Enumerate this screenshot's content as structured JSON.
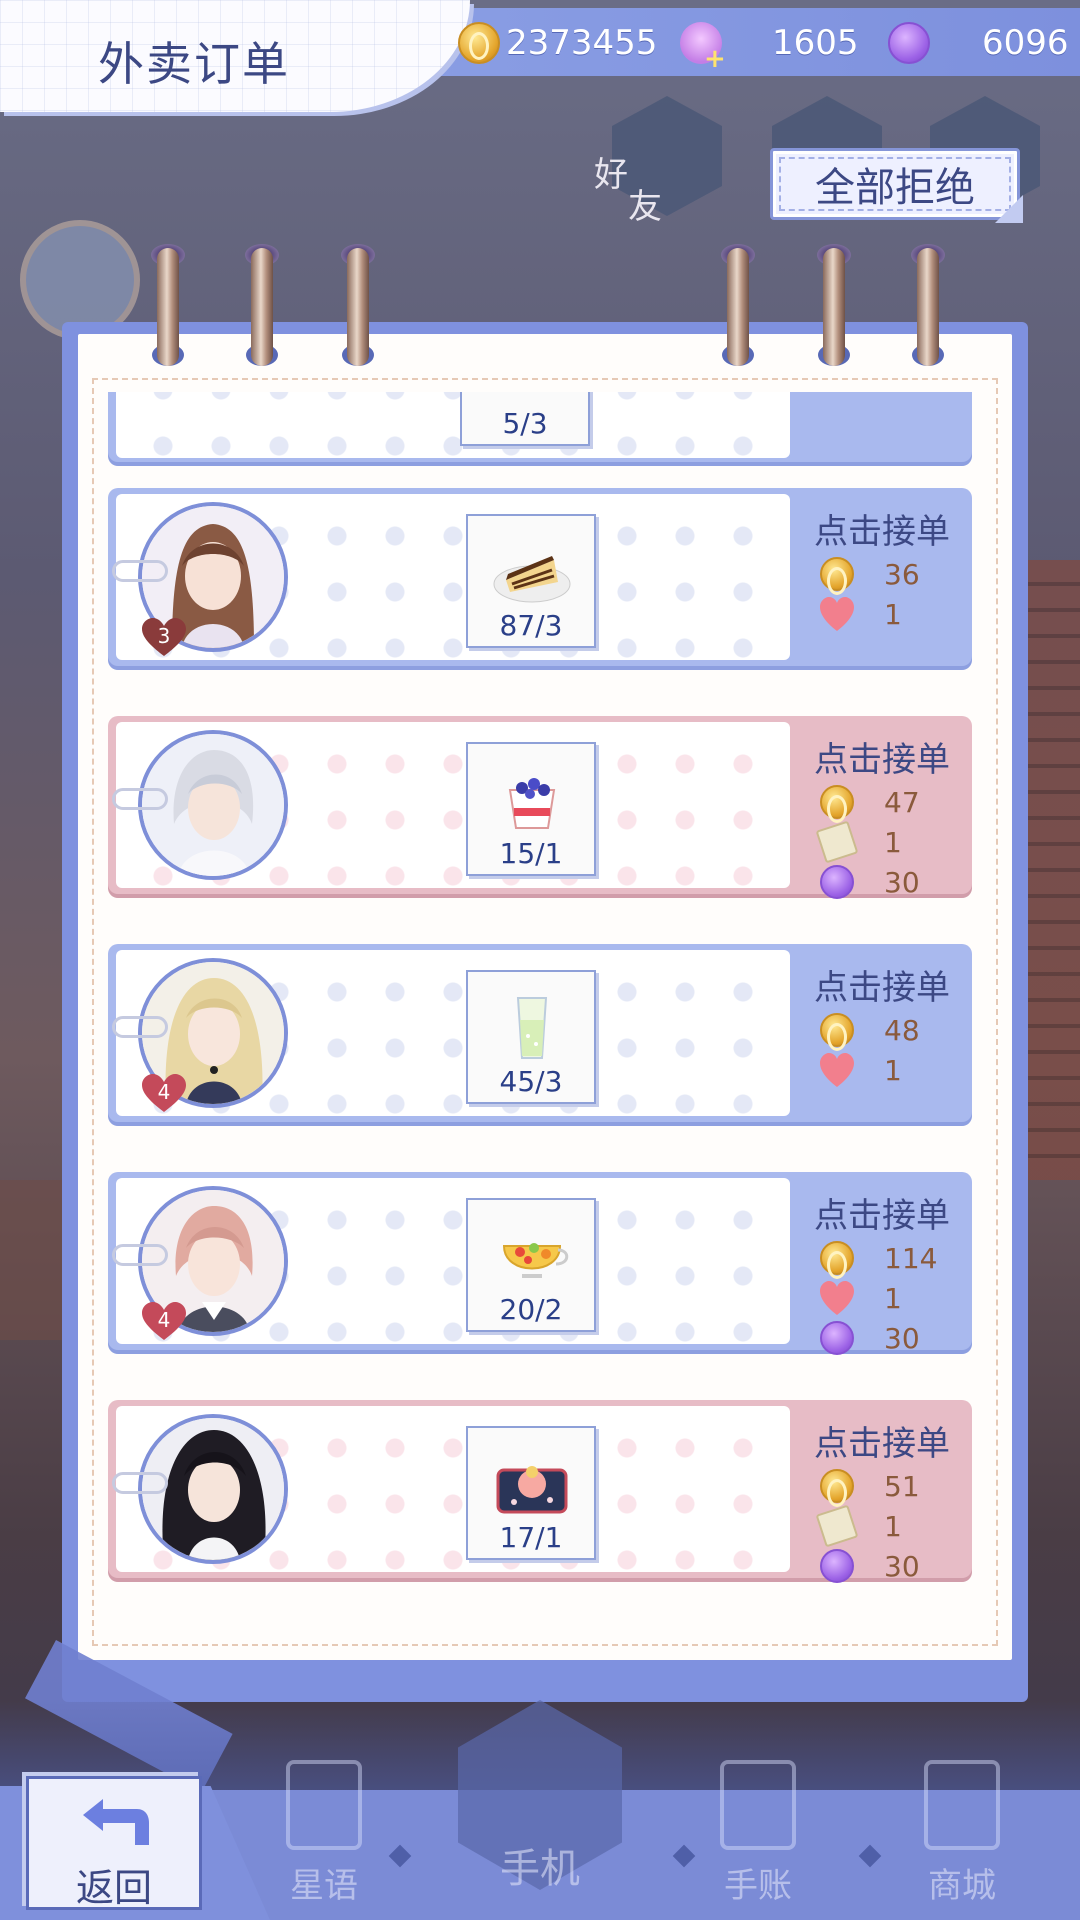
{
  "header": {
    "title": "外卖订单"
  },
  "currencies": [
    {
      "icon": "gold-coin-icon",
      "value": "2373455"
    },
    {
      "icon": "swan-icon",
      "value": "1605"
    },
    {
      "icon": "star-coin-icon",
      "value": "6096"
    }
  ],
  "background": {
    "friend_label": "好",
    "friend_label_2": "友"
  },
  "actions": {
    "reject_all": "全部拒绝"
  },
  "orders_partial": {
    "count": "5/3"
  },
  "orders": [
    {
      "theme": "blue",
      "affinity": "3",
      "food": "cheesecake-icon",
      "count": "87/3",
      "accept": "点击接单",
      "rewards": [
        {
          "icon": "gold-coin-icon",
          "value": "36"
        },
        {
          "icon": "heart-icon",
          "value": "1"
        }
      ]
    },
    {
      "theme": "pink",
      "affinity": "",
      "food": "blueberry-pudding-icon",
      "count": "15/1",
      "accept": "点击接单",
      "rewards": [
        {
          "icon": "gold-coin-icon",
          "value": "47"
        },
        {
          "icon": "ticket-icon",
          "value": "1"
        },
        {
          "icon": "star-coin-icon",
          "value": "30"
        }
      ]
    },
    {
      "theme": "blue",
      "affinity": "4",
      "food": "lemonade-icon",
      "count": "45/3",
      "accept": "点击接单",
      "rewards": [
        {
          "icon": "gold-coin-icon",
          "value": "48"
        },
        {
          "icon": "heart-icon",
          "value": "1"
        }
      ]
    },
    {
      "theme": "blue",
      "affinity": "4",
      "food": "fruit-tea-icon",
      "count": "20/2",
      "accept": "点击接单",
      "rewards": [
        {
          "icon": "gold-coin-icon",
          "value": "114"
        },
        {
          "icon": "heart-icon",
          "value": "1"
        },
        {
          "icon": "star-coin-icon",
          "value": "30"
        }
      ]
    },
    {
      "theme": "pink",
      "affinity": "",
      "food": "peach-dessert-icon",
      "count": "17/1",
      "accept": "点击接单",
      "rewards": [
        {
          "icon": "gold-coin-icon",
          "value": "51"
        },
        {
          "icon": "ticket-icon",
          "value": "1"
        },
        {
          "icon": "star-coin-icon",
          "value": "30"
        }
      ]
    }
  ],
  "nav": {
    "back": "返回",
    "items": [
      {
        "label": "星语",
        "icon": "cards-icon"
      },
      {
        "label": "手机",
        "icon": "phone-icon"
      },
      {
        "label": "手账",
        "icon": "calendar-icon"
      },
      {
        "label": "商城",
        "icon": "shop-bag-icon"
      }
    ]
  },
  "colors": {
    "accent": "#7f91df",
    "title_text": "#3c4884",
    "pink_order": "#e7bcc6",
    "blue_order": "#a9b9ee"
  }
}
